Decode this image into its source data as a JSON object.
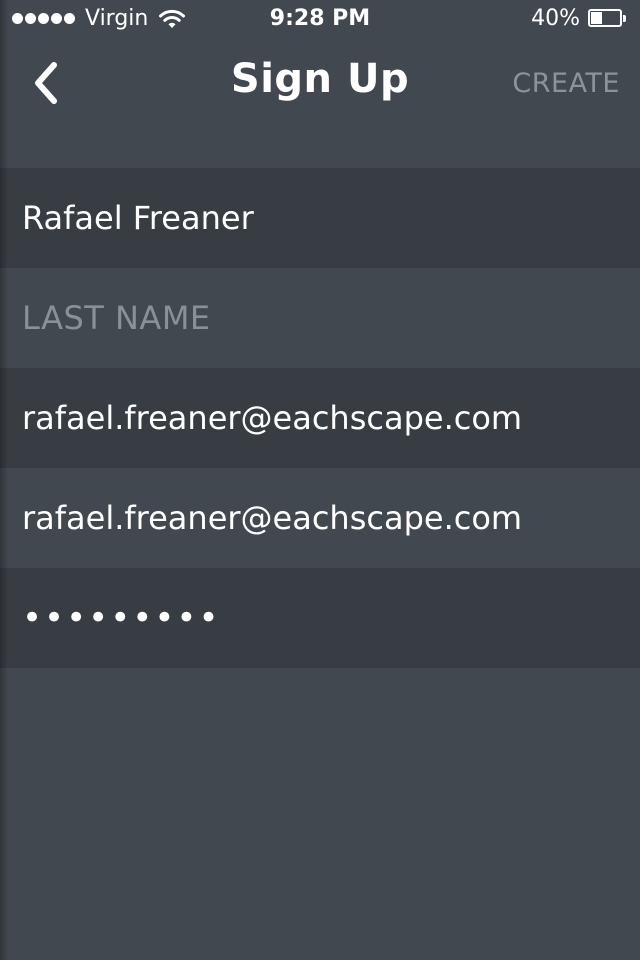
{
  "status_bar": {
    "carrier": "Virgin",
    "time": "9:28 PM",
    "battery_percent": "40%",
    "battery_level": 0.4,
    "signal_bars": 5
  },
  "nav": {
    "title": "Sign Up",
    "create_label": "CREATE",
    "back_icon": "chevron-left-icon"
  },
  "form": {
    "first_name": {
      "value": "Rafael Freaner",
      "placeholder": ""
    },
    "last_name": {
      "value": "",
      "placeholder": "LAST NAME"
    },
    "email": {
      "value": "rafael.freaner@eachscape.com",
      "placeholder": ""
    },
    "email_confirm": {
      "value": "rafael.freaner@eachscape.com",
      "placeholder": ""
    },
    "password": {
      "value": "abcdefghi",
      "placeholder": ""
    }
  },
  "colors": {
    "background": "#424850",
    "row_dark": "#383d44",
    "placeholder": "#8a9097",
    "create_inactive": "#8d939a"
  }
}
